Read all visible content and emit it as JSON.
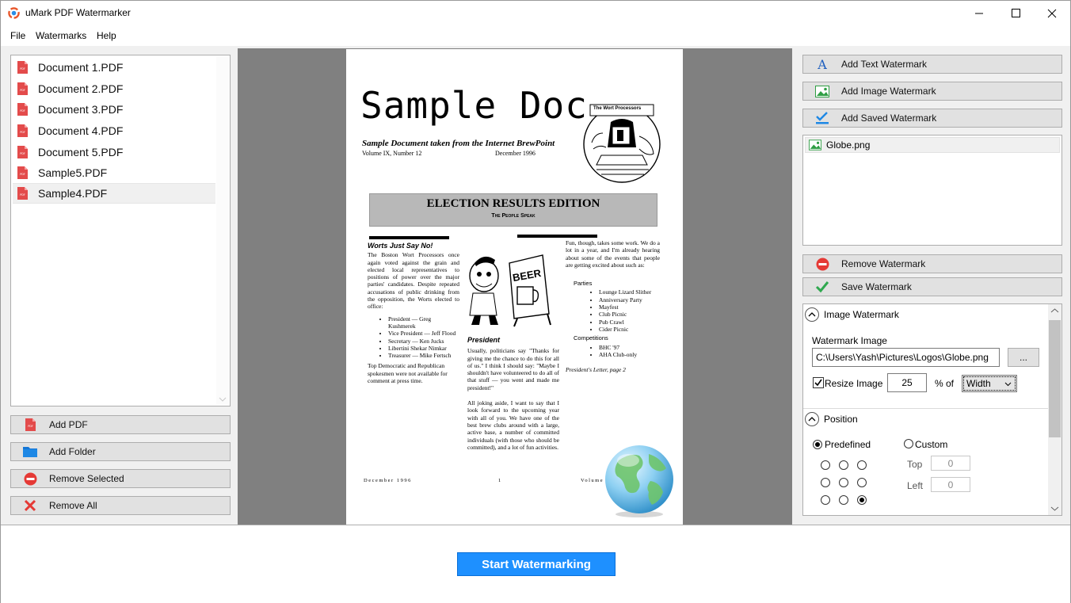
{
  "window": {
    "title": "uMark PDF Watermarker"
  },
  "menu": [
    "File",
    "Watermarks",
    "Help"
  ],
  "files": [
    "Document 1.PDF",
    "Document 2.PDF",
    "Document 3.PDF",
    "Document 4.PDF",
    "Document 5.PDF",
    "Sample5.PDF",
    "Sample4.PDF"
  ],
  "selected_file": "Sample4.PDF",
  "left_buttons": {
    "add_pdf": "Add PDF",
    "add_folder": "Add Folder",
    "remove_selected": "Remove Selected",
    "remove_all": "Remove All"
  },
  "right_buttons": {
    "add_text": "Add Text Watermark",
    "add_image": "Add Image Watermark",
    "add_saved": "Add Saved Watermark",
    "remove": "Remove Watermark",
    "save": "Save Watermark"
  },
  "watermarks": [
    "Globe.png"
  ],
  "image_watermark": {
    "section_title": "Image Watermark",
    "label": "Watermark Image",
    "path": "C:\\Users\\Yash\\Pictures\\Logos\\Globe.png",
    "browse": "...",
    "resize_label": "Resize Image",
    "resize_checked": true,
    "resize_value": "25",
    "percent_of": "% of",
    "dimension": "Width"
  },
  "position": {
    "section_title": "Position",
    "predefined": "Predefined",
    "custom": "Custom",
    "top_label": "Top",
    "top_value": "0",
    "left_label": "Left",
    "left_value": "0",
    "selected_cell": 8
  },
  "start_button": "Start Watermarking",
  "doc": {
    "title": "Sample Doc",
    "subtitle": "Sample Document taken from the Internet BrewPoint",
    "volume": "Volume IX, Number 12",
    "date": "December 1996",
    "logo_text": "The Wort Processors",
    "banner_title": "ELECTION RESULTS EDITION",
    "banner_sub": "The People Speak",
    "col1_head": "Worts Just Say No!",
    "col1_body": "The Boston Wort Processors once again voted against the grain and elected local representatives to positions of power over the major parties' candidates. Despite repeated accusations of public drinking from the opposition, the Worts elected to office:",
    "col1_list": [
      "President — Greg Kushmerek",
      "Vice President — Jeff Flood",
      "Secretary — Ken Jucks",
      "Libertini Shekar Nimkar",
      "Treasurer — Mike Fertsch"
    ],
    "col1_foot": "Top Democratic and Republican spokesmen were not available for comment at press time.",
    "beer_sign": "BEER",
    "col2_head": "President",
    "col2_p1": "Usually, politicians say \"Thanks for giving me the chance to do this for all of us.\" I think I should say: \"Maybe I shouldn't have volunteered to do all of that stuff — you went and made me president!\"",
    "col2_p2": "All joking aside, I want to say that I look forward to the upcoming year with all of you. We have one of the best brew clubs around with a large, active base, a number of committed individuals (with those who should be committed), and a lot of fun activities.",
    "col3_p1": "Fun, though, takes some work. We do a lot in a year, and I'm already hearing about some of the events that people are getting excited about such as:",
    "parties_label": "Parties",
    "parties": [
      "Lounge Lizard Slither",
      "Anniversary Party",
      "Mayfest",
      "Club Picnic",
      "Pub Crawl",
      "Cider Picnic"
    ],
    "competitions_label": "Competitions",
    "competitions": [
      "BHC '97",
      "AHA Club-only"
    ],
    "col3_foot": "President's Letter, page 2",
    "footer_left": "December 1996",
    "footer_mid": "1",
    "footer_right": "Volume IX, Number 12"
  }
}
